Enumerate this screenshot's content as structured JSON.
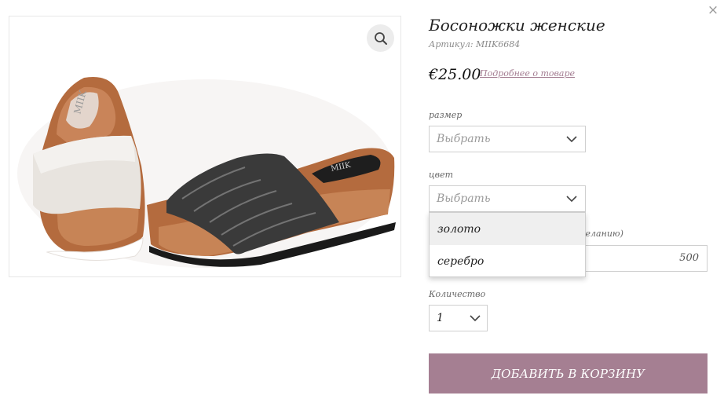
{
  "close_icon": "×",
  "product": {
    "title": "Босоножки женские",
    "sku": "Артикул: MIIK6684",
    "price": "€25.00",
    "more_link": "Подробнее о товаре",
    "image_logo_text": "MIIK"
  },
  "options": {
    "size": {
      "label": "размер",
      "value": "Выбрать"
    },
    "color": {
      "label": "цвет",
      "value": "Выбрать",
      "dropdown_items": [
        "золото",
        "серебро"
      ],
      "highlighted_index": 0
    },
    "amount": {
      "label_fragment": "желанию)",
      "value": "500"
    },
    "quantity": {
      "label": "Количество",
      "value": "1"
    }
  },
  "add_to_cart_label": "ДОБАВИТЬ В КОРЗИНУ",
  "colors": {
    "accent": "#a57f92",
    "link": "#a47d92",
    "border": "#cfcfcf",
    "highlight": "#efefef"
  },
  "icons": {
    "close": "close-icon",
    "zoom": "magnifier-icon",
    "chevron": "chevron-down-icon"
  }
}
